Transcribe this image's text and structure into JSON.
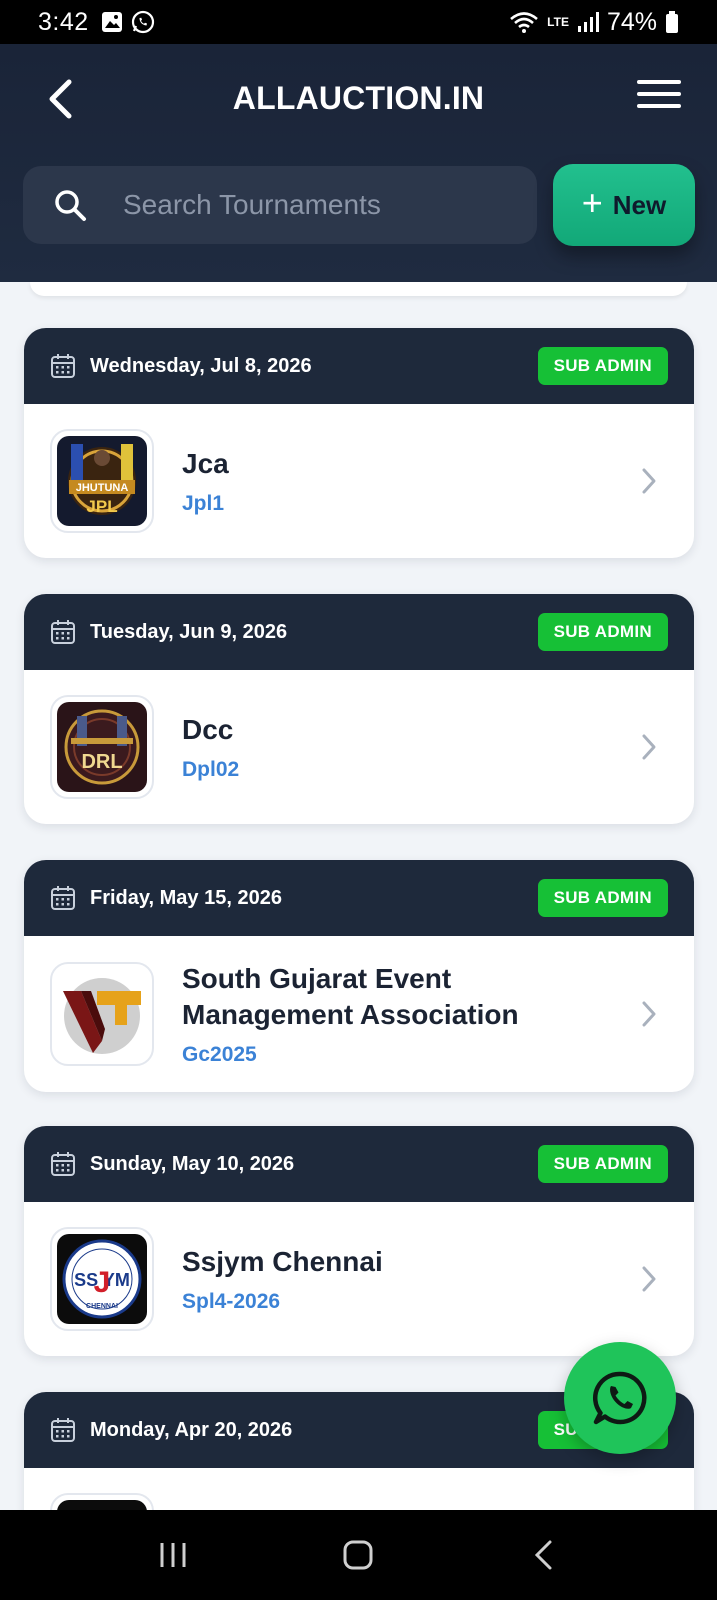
{
  "status_bar": {
    "time": "3:42",
    "battery": "74%",
    "network_label": "LTE"
  },
  "header": {
    "title": "ALLAUCTION.IN",
    "search_placeholder": "Search Tournaments",
    "new_button_label": "New"
  },
  "tournaments": [
    {
      "date": "Wednesday, Jul 8, 2026",
      "role": "SUB ADMIN",
      "name": "Jca",
      "code": "Jpl1",
      "logo": "jhutuna-jpl-logo",
      "logo_text": "JHUTUNA JPL"
    },
    {
      "date": "Tuesday, Jun 9, 2026",
      "role": "SUB ADMIN",
      "name": "Dcc",
      "code": "Dpl02",
      "logo": "drl-logo",
      "logo_text": "DRL"
    },
    {
      "date": "Friday, May 15, 2026",
      "role": "SUB ADMIN",
      "name": "South Gujarat Event Management Association",
      "code": "Gc2025",
      "logo": "vt-logo",
      "logo_text": "VT"
    },
    {
      "date": "Sunday, May 10, 2026",
      "role": "SUB ADMIN",
      "name": "Ssjym Chennai",
      "code": "Spl4-2026",
      "logo": "ssjym-logo",
      "logo_text": "SSJYM"
    },
    {
      "date": "Monday, Apr 20, 2026",
      "role": "SUB ADMIN"
    }
  ],
  "icons": {
    "back": "chevron-left-icon",
    "menu": "hamburger-menu-icon",
    "search": "search-icon",
    "calendar": "calendar-icon",
    "chevron": "chevron-right-icon",
    "whatsapp": "whatsapp-icon"
  },
  "colors": {
    "header_bg": "#1e293b",
    "accent_green": "#16c036",
    "new_button": "#1fb886",
    "code_blue": "#3b82d6",
    "whatsapp": "#1fc45a"
  }
}
